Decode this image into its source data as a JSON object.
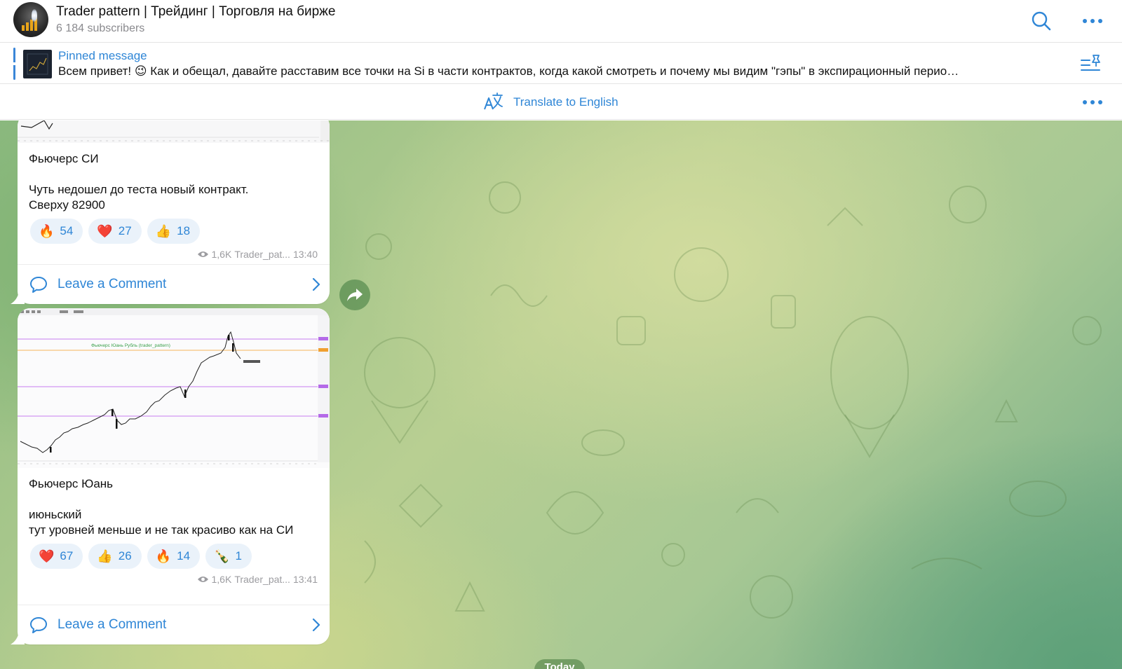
{
  "header": {
    "title": "Trader pattern | Трейдинг | Торговля на бирже",
    "subscribers": "6 184 subscribers",
    "search_icon": "search-icon",
    "more_icon": "more-icon"
  },
  "pinned": {
    "title": "Pinned message",
    "text": "Всем привет!  😉  Как и обещал, давайте расставим все точки на Si в части контрактов, когда какой смотреть и почему мы видим \"гэпы\" в экспирационный перио…",
    "icon": "pin-list-icon"
  },
  "translate": {
    "label": "Translate to English",
    "icon": "translate-icon"
  },
  "messages": [
    {
      "caption": "Фьючерс СИ\n\nЧуть недошел до теста новый контракт.\nСверху 82900",
      "reactions": [
        {
          "emoji": "🔥",
          "count": "54"
        },
        {
          "emoji": "❤️",
          "count": "27"
        },
        {
          "emoji": "👍",
          "count": "18"
        }
      ],
      "views": "1,6K",
      "author": "Trader_pat...",
      "time": "13:40",
      "comment_label": "Leave a Comment"
    },
    {
      "chart_watermark": "Фьючерс Юань Рубль (trader_pattern)",
      "caption": "Фьючерс Юань\n\nиюньский\nтут уровней меньше и не так красиво как на СИ",
      "reactions": [
        {
          "emoji": "❤️",
          "count": "67"
        },
        {
          "emoji": "👍",
          "count": "26"
        },
        {
          "emoji": "🔥",
          "count": "14"
        },
        {
          "emoji": "🍾",
          "count": "1"
        }
      ],
      "views": "1,6K",
      "author": "Trader_pat...",
      "time": "13:41",
      "comment_label": "Leave a Comment"
    }
  ],
  "date_badge": "Today",
  "colors": {
    "accent": "#2f86d6",
    "reaction_bg": "#eaf2fa",
    "chat_green": "#9fc48c"
  }
}
